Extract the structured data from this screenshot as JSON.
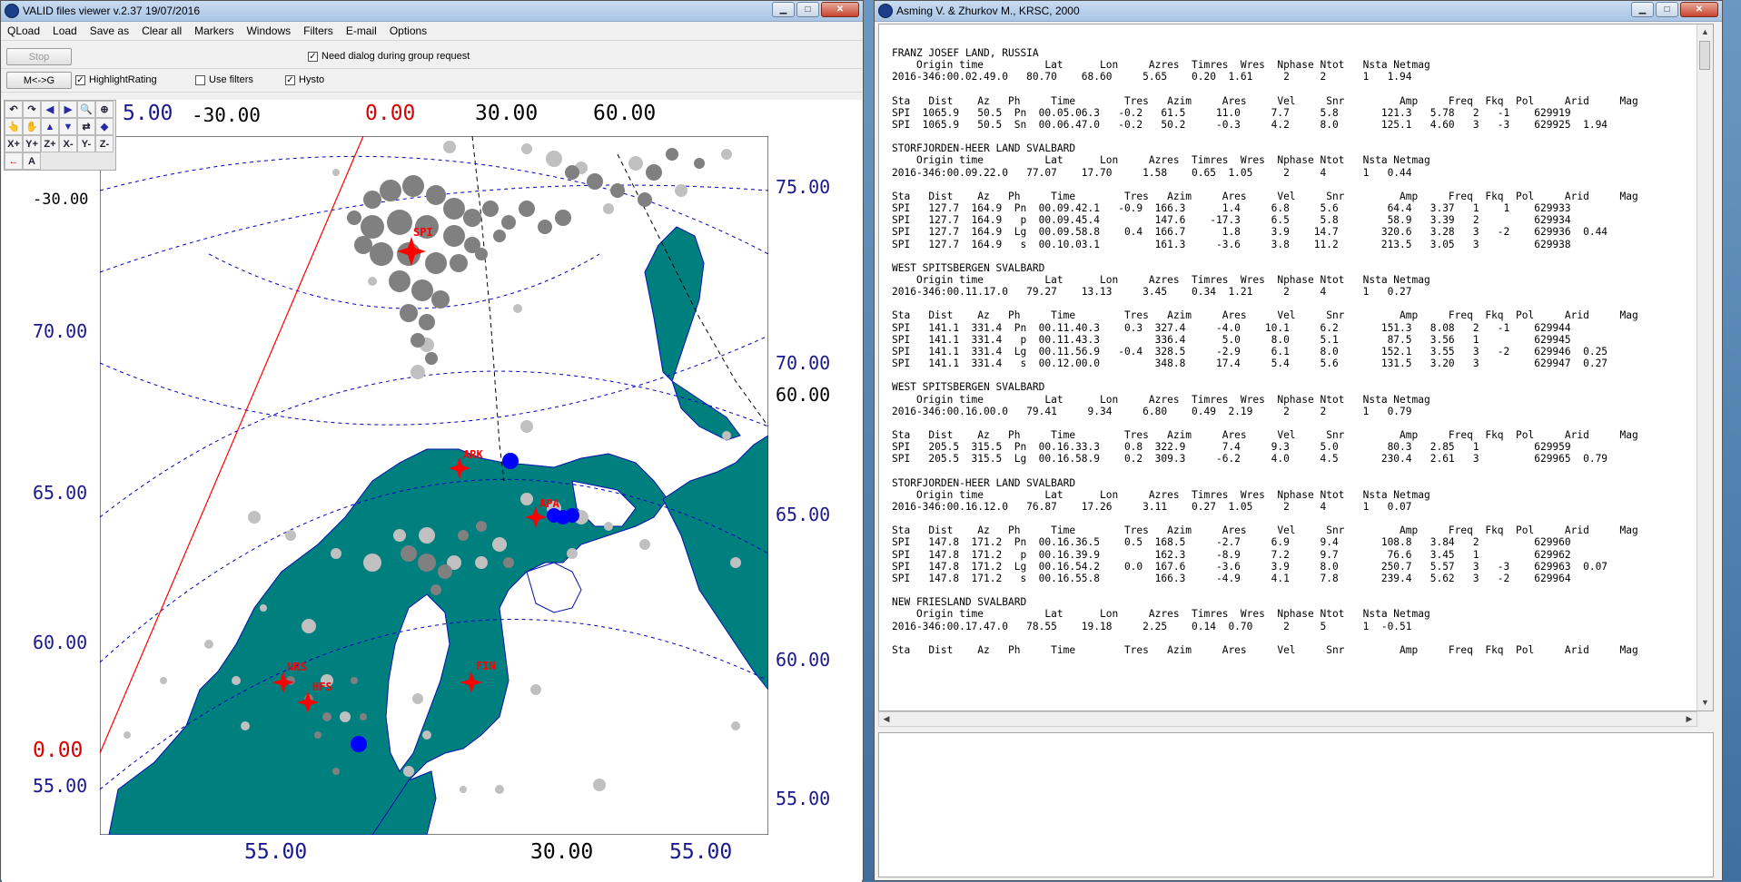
{
  "left_window": {
    "title": "VALID files viewer v.2.37 19/07/2016",
    "menu": [
      "QLoad",
      "Load",
      "Save as",
      "Clear all",
      "Markers",
      "Windows",
      "Filters",
      "E-mail",
      "Options"
    ],
    "stop_label": "Stop",
    "need_dialog_label": "Need dialog during group request",
    "need_dialog_checked": true,
    "mg_label": "M<->G",
    "highlight_label": "HighlightRating",
    "highlight_checked": true,
    "use_filters_label": "Use filters",
    "use_filters_checked": false,
    "hysto_label": "Hysto",
    "hysto_checked": true,
    "tools": [
      "↶",
      "↷",
      "◀",
      "▶",
      "🔍",
      "⊕",
      "👆",
      "✋",
      "▲",
      "▼",
      "⇄",
      "◆",
      "X+",
      "Y+",
      "Z+",
      "X-",
      "Y-",
      "Z-",
      "←",
      "A"
    ],
    "map": {
      "top_labels": {
        "a": "5.00",
        "b": "-30.00",
        "c": "0.00",
        "d": "30.00",
        "e": "60.00"
      },
      "left_labels": {
        "a": "-30.00",
        "b": "70.00",
        "c": "65.00",
        "d": "60.00",
        "e": "0.00",
        "f": "55.00"
      },
      "right_labels": {
        "a": "75.00",
        "b": "70.00",
        "c": "60.00",
        "d": "65.00",
        "e": "60.00",
        "f": "55.00"
      },
      "bottom_labels": {
        "a": "55.00",
        "b": "30.00",
        "c": "55.00"
      },
      "stations": {
        "spi": "SPI",
        "ark": "ARK",
        "apa": "APA",
        "nrs": "NRS",
        "hfs": "HFS",
        "fin": "FIN"
      },
      "colors": {
        "land": "#007f7f",
        "gray_event": "#808080",
        "light_event": "#c0c0c0",
        "blue_event": "#0000ff",
        "station": "#ff0000",
        "grid": "#0000c0"
      }
    }
  },
  "right_window": {
    "title": "Asming V. & Zhurkov M., KRSC, 2000",
    "text": "FRANZ JOSEF LAND, RUSSIA\n    Origin time          Lat      Lon     Azres  Timres  Wres  Nphase Ntot   Nsta Netmag\n2016-346:00.02.49.0   80.70    68.60     5.65    0.20  1.61     2     2      1   1.94\n\nSta   Dist    Az   Ph     Time        Tres   Azim     Ares     Vel     Snr         Amp     Freq  Fkq  Pol     Arid     Mag\nSPI  1065.9   50.5  Pn  00.05.06.3   -0.2   61.5     11.0     7.7     5.8       121.3   5.78   2   -1    629919\nSPI  1065.9   50.5  Sn  00.06.47.0   -0.2   50.2     -0.3     4.2     8.0       125.1   4.60   3   -3    629925  1.94\n\nSTORFJORDEN-HEER LAND SVALBARD\n    Origin time          Lat      Lon     Azres  Timres  Wres  Nphase Ntot   Nsta Netmag\n2016-346:00.09.22.0   77.07    17.70     1.58    0.65  1.05     2     4      1   0.44\n\nSta   Dist    Az   Ph     Time        Tres   Azim     Ares     Vel     Snr         Amp     Freq  Fkq  Pol     Arid     Mag\nSPI   127.7  164.9  Pn  00.09.42.1   -0.9  166.3      1.4     6.8     5.6        64.4   3.37   1    1    629933\nSPI   127.7  164.9   p  00.09.45.4         147.6    -17.3     6.5     5.8        58.9   3.39   2         629934\nSPI   127.7  164.9  Lg  00.09.58.8    0.4  166.7      1.8     3.9    14.7       320.6   3.28   3   -2    629936  0.44\nSPI   127.7  164.9   s  00.10.03.1         161.3     -3.6     3.8    11.2       213.5   3.05   3         629938\n\nWEST SPITSBERGEN SVALBARD\n    Origin time          Lat      Lon     Azres  Timres  Wres  Nphase Ntot   Nsta Netmag\n2016-346:00.11.17.0   79.27    13.13     3.45    0.34  1.21     2     4      1   0.27\n\nSta   Dist    Az   Ph     Time        Tres   Azim     Ares     Vel     Snr         Amp     Freq  Fkq  Pol     Arid     Mag\nSPI   141.1  331.4  Pn  00.11.40.3    0.3  327.4     -4.0    10.1     6.2       151.3   8.08   2   -1    629944\nSPI   141.1  331.4   p  00.11.43.3         336.4      5.0     8.0     5.1        87.5   3.56   1         629945\nSPI   141.1  331.4  Lg  00.11.56.9   -0.4  328.5     -2.9     6.1     8.0       152.1   3.55   3   -2    629946  0.25\nSPI   141.1  331.4   s  00.12.00.0         348.8     17.4     5.4     5.6       131.5   3.20   3         629947  0.27\n\nWEST SPITSBERGEN SVALBARD\n    Origin time          Lat      Lon     Azres  Timres  Wres  Nphase Ntot   Nsta Netmag\n2016-346:00.16.00.0   79.41     9.34     6.80    0.49  2.19     2     2      1   0.79\n\nSta   Dist    Az   Ph     Time        Tres   Azim     Ares     Vel     Snr         Amp     Freq  Fkq  Pol     Arid     Mag\nSPI   205.5  315.5  Pn  00.16.33.3    0.8  322.9      7.4     9.3     5.0        80.3   2.85   1         629959\nSPI   205.5  315.5  Lg  00.16.58.9    0.2  309.3     -6.2     4.0     4.5       230.4   2.61   3         629965  0.79\n\nSTORFJORDEN-HEER LAND SVALBARD\n    Origin time          Lat      Lon     Azres  Timres  Wres  Nphase Ntot   Nsta Netmag\n2016-346:00.16.12.0   76.87    17.26     3.11    0.27  1.05     2     4      1   0.07\n\nSta   Dist    Az   Ph     Time        Tres   Azim     Ares     Vel     Snr         Amp     Freq  Fkq  Pol     Arid     Mag\nSPI   147.8  171.2  Pn  00.16.36.5    0.5  168.5     -2.7     6.9     9.4       108.8   3.84   2         629960\nSPI   147.8  171.2   p  00.16.39.9         162.3     -8.9     7.2     9.7        76.6   3.45   1         629962\nSPI   147.8  171.2  Lg  00.16.54.2    0.0  167.6     -3.6     3.9     8.0       250.7   5.57   3   -3    629963  0.07\nSPI   147.8  171.2   s  00.16.55.8         166.3     -4.9     4.1     7.8       239.4   5.62   3   -2    629964\n\nNEW FRIESLAND SVALBARD\n    Origin time          Lat      Lon     Azres  Timres  Wres  Nphase Ntot   Nsta Netmag\n2016-346:00.17.47.0   78.55    19.18     2.25    0.14  0.70     2     5      1  -0.51\n\nSta   Dist    Az   Ph     Time        Tres   Azim     Ares     Vel     Snr         Amp     Freq  Fkq  Pol     Arid     Mag"
  }
}
